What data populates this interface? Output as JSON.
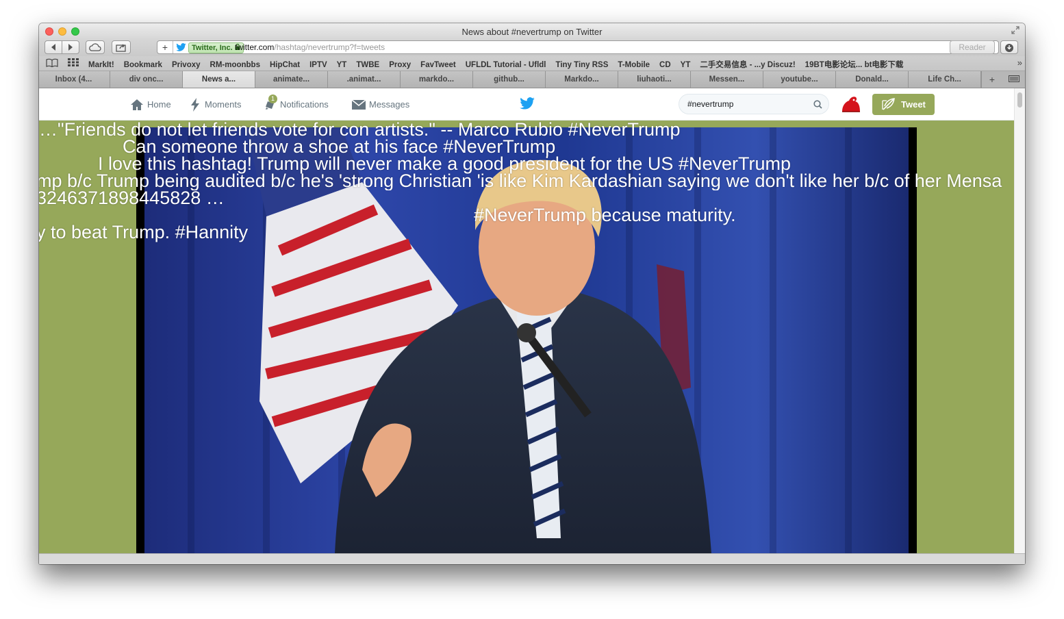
{
  "window": {
    "title": "News about #nevertrump on Twitter"
  },
  "toolbar": {
    "ev_label": "Twitter, Inc.",
    "url_domain": "twitter.com",
    "url_path": "/hashtag/nevertrump?f=tweets",
    "reader_label": "Reader"
  },
  "bookmarks": [
    "MarkIt!",
    "Bookmark",
    "Privoxy",
    "RM-moonbbs",
    "HipChat",
    "IPTV",
    "YT",
    "TWBE",
    "Proxy",
    "FavTweet",
    "UFLDL Tutorial - Ufldl",
    "Tiny Tiny RSS",
    "T-Mobile",
    "CD",
    "YT",
    "二手交易信息 - ...y Discuz!",
    "19BT电影论坛... bt电影下载"
  ],
  "tabs": [
    {
      "label": "Inbox (4...",
      "active": false
    },
    {
      "label": "div onc...",
      "active": false
    },
    {
      "label": "News a...",
      "active": true
    },
    {
      "label": "animate...",
      "active": false
    },
    {
      "label": ".animat...",
      "active": false
    },
    {
      "label": "markdo...",
      "active": false
    },
    {
      "label": "github...",
      "active": false
    },
    {
      "label": "Markdo...",
      "active": false
    },
    {
      "label": "liuhaoti...",
      "active": false
    },
    {
      "label": "Messen...",
      "active": false
    },
    {
      "label": "youtube...",
      "active": false
    },
    {
      "label": "Donald...",
      "active": false
    },
    {
      "label": "Life Ch...",
      "active": false
    }
  ],
  "twitter_nav": {
    "home": "Home",
    "moments": "Moments",
    "notifications": "Notifications",
    "notifications_count": "1",
    "messages": "Messages",
    "search_value": "#nevertrump",
    "tweet_button": "Tweet"
  },
  "colors": {
    "theme": "#96a85a",
    "twitter_blue": "#1da1f2"
  },
  "ticker": [
    "…\"Friends do not let friends vote for con artists.\" -- Marco Rubio #NeverTrump",
    "Can someone throw a shoe at his face #NeverTrump",
    "I love this hashtag! Trump will never make a good president for the US #NeverTrump",
    "mp b/c Trump being audited b/c he's 'strong Christian 'is like Kim Kardashian saying we don't like her b/c of her Mensa",
    "3246371898445828 …",
    "#NeverTrump because maturity.",
    "y to beat Trump. #Hannity"
  ]
}
